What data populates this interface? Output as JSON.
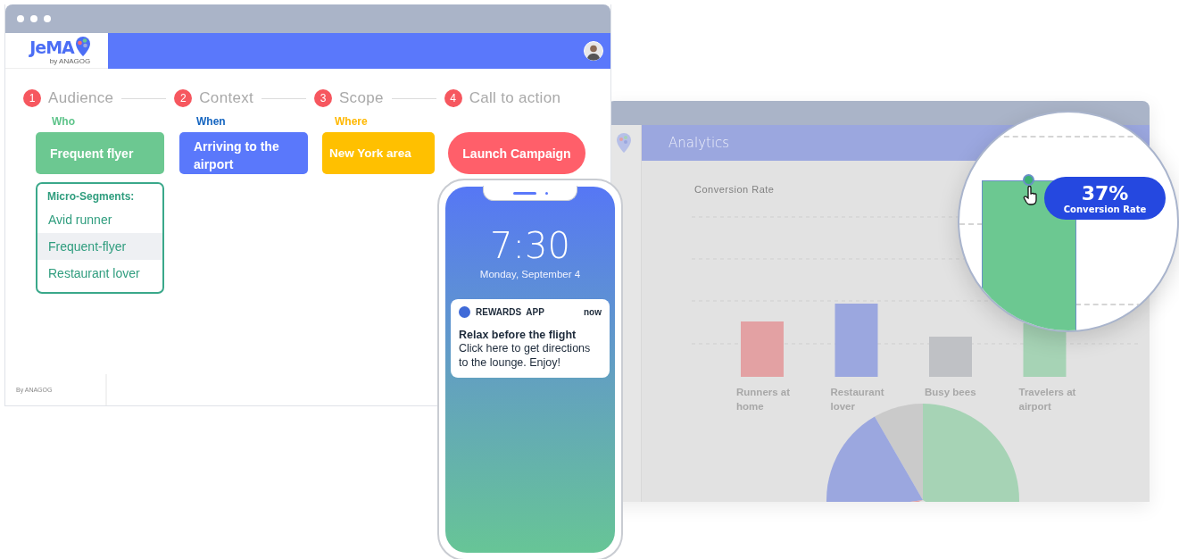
{
  "analytics_window": {
    "title": "Analytics",
    "chart_title": "Conversion Rate",
    "bars": [
      {
        "label": "Runners at home",
        "color": "#e3a1a3"
      },
      {
        "label": "Restaurant lover",
        "color": "#9ba7df"
      },
      {
        "label": "Busy bees",
        "color": "#bfc1c5"
      },
      {
        "label": "Travelers at airport",
        "color": "#a6d3b5"
      }
    ]
  },
  "editor_window": {
    "logo": "JeMA",
    "logo_sub": "by ANAGOG",
    "steps": [
      {
        "number": "1",
        "label": "Audience"
      },
      {
        "number": "2",
        "label": "Context"
      },
      {
        "number": "3",
        "label": "Scope"
      },
      {
        "number": "4",
        "label": "Call to action"
      }
    ],
    "cards": [
      {
        "kind": "audience",
        "caption": "Who",
        "label": "Frequent flyer"
      },
      {
        "kind": "context",
        "caption": "When",
        "label": "Arriving to the airport"
      },
      {
        "kind": "scope",
        "caption": "Where",
        "label": "New York area"
      },
      {
        "kind": "action",
        "label": "Launch Campaign"
      }
    ],
    "micro_segments": {
      "title": "Micro-Segments:",
      "items": [
        {
          "label": "Avid runner",
          "selected": false
        },
        {
          "label": "Frequent-flyer",
          "selected": true
        },
        {
          "label": "Restaurant lover",
          "selected": false
        }
      ]
    },
    "footer": "By ANAGOG"
  },
  "phone": {
    "time": "7:30",
    "date": "Monday, September 4",
    "notification": {
      "app": "REWARDS  APP",
      "time": "now",
      "title": "Relax before the flight",
      "body": "Click here to get directions to the lounge. Enjoy!"
    }
  },
  "magnifier": {
    "value": "37%",
    "label": "Conversion Rate"
  }
}
